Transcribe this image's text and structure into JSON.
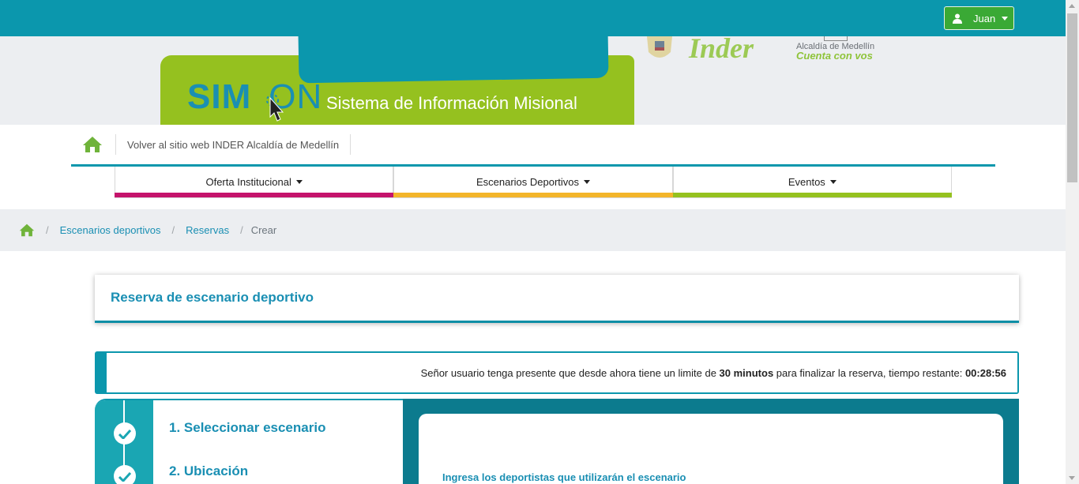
{
  "user_menu": {
    "name": "Juan",
    "icon": "user-icon"
  },
  "header": {
    "logo_text_a": "SIM",
    "logo_text_b": "ON",
    "title": "Sistema de Información Misional",
    "inder_logo": "Inder",
    "alcaldia_line1": "Alcaldía de Medellín",
    "alcaldia_line2": "Cuenta con vos"
  },
  "nav": {
    "home_icon": "home-icon",
    "site_link": "Volver al sitio web INDER Alcaldía de Medellín",
    "menu": [
      {
        "label": "Oferta Institucional",
        "color": "#c4136b"
      },
      {
        "label": "Escenarios Deportivos",
        "color": "#f3b52a"
      },
      {
        "label": "Eventos",
        "color": "#95c11f"
      }
    ]
  },
  "breadcrumb": {
    "sep": "/",
    "items": [
      "Escenarios deportivos",
      "Reservas"
    ],
    "current": "Crear"
  },
  "page": {
    "title": "Reserva de escenario deportivo"
  },
  "notice": {
    "text_before": "Señor usuario tenga presente que desde ahora tiene un limite de ",
    "limit": "30 minutos",
    "text_after": " para finalizar la reserva, tiempo restante: ",
    "remaining": "00:28:56"
  },
  "steps": [
    {
      "label": "1. Seleccionar escenario",
      "status": "complete"
    },
    {
      "label": "2. Ubicación",
      "status": "complete"
    }
  ],
  "panel": {
    "heading": "Ingresa los deportistas que utilizarán el escenario"
  },
  "colors": {
    "primary": "#0b97ad",
    "green": "#95c11f",
    "button_green": "#3aa935"
  }
}
